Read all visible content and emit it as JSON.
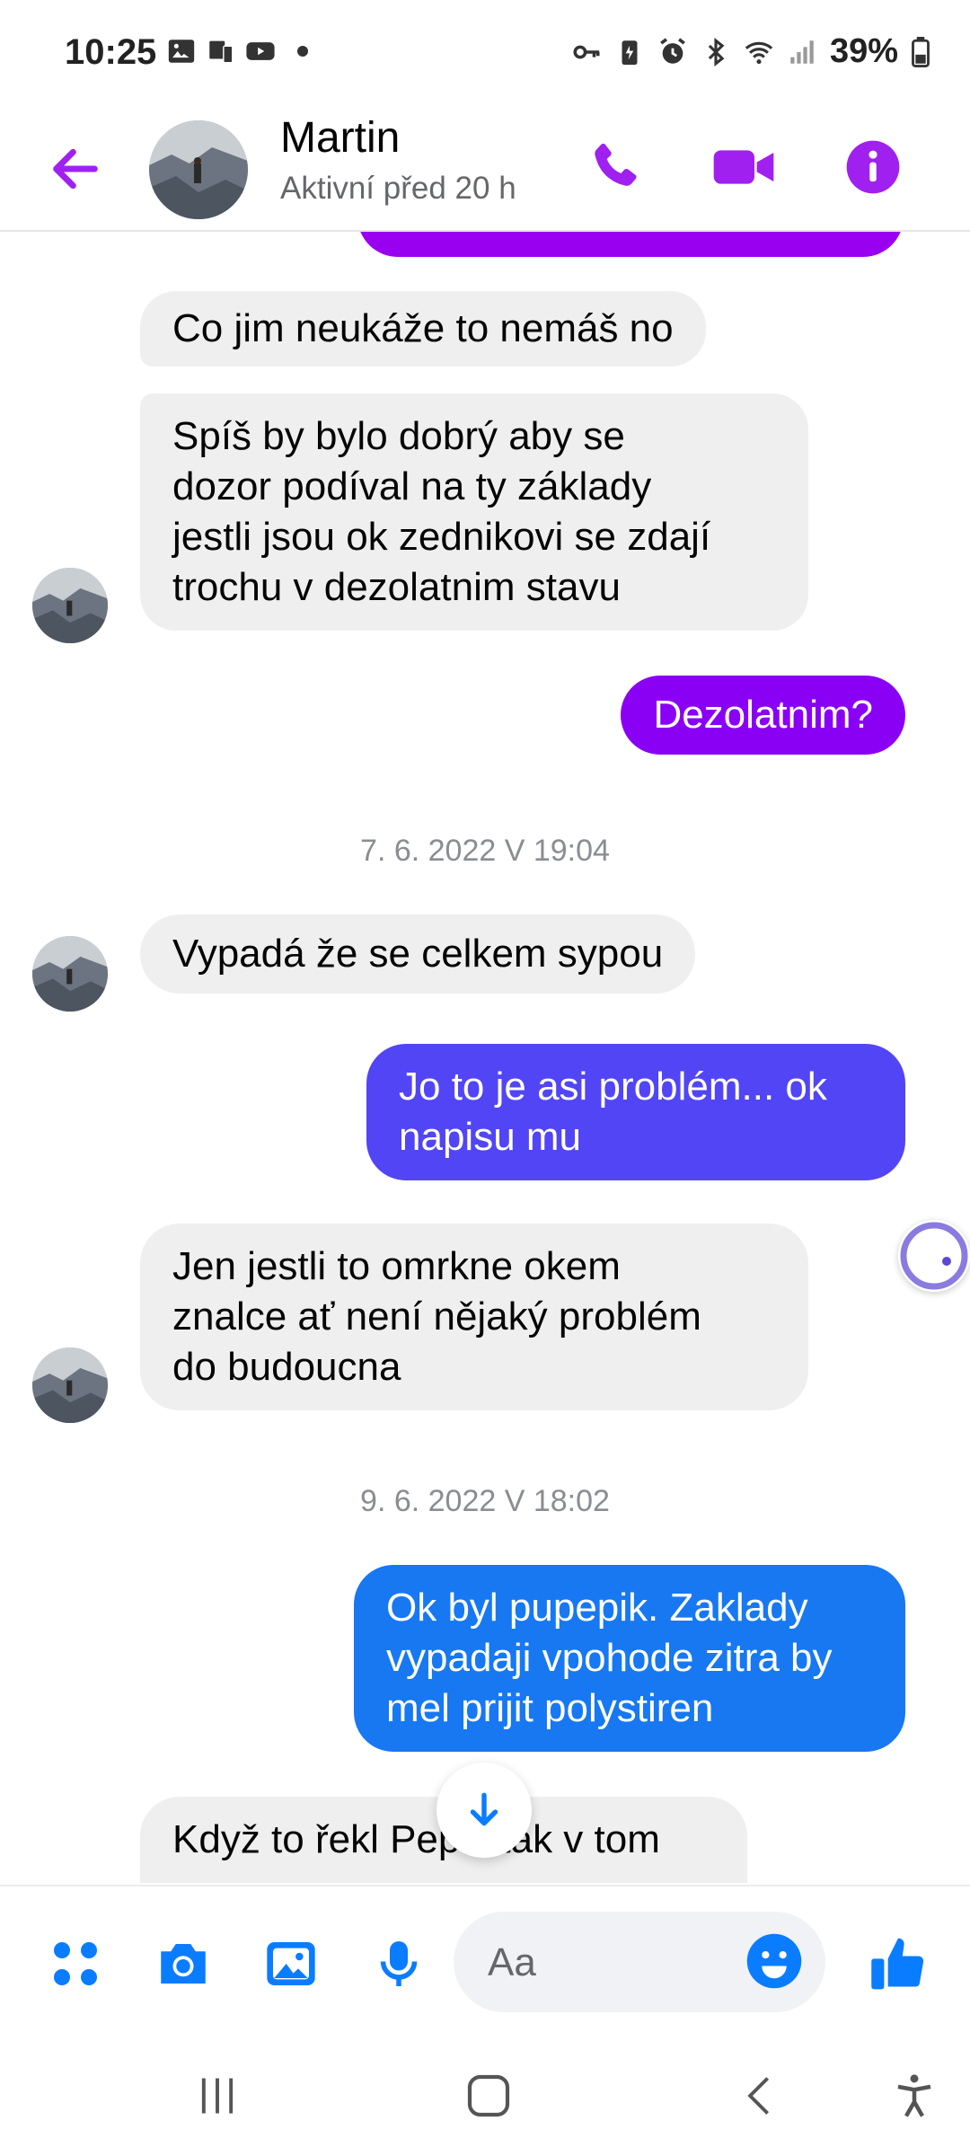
{
  "status_bar": {
    "time": "10:25",
    "battery": "39%"
  },
  "header": {
    "contact_name": "Martin",
    "contact_status": "Aktivní před 20 h"
  },
  "messages": [
    {
      "direction": "incoming",
      "text": "Co jim neukáže to nemáš no"
    },
    {
      "direction": "incoming",
      "text": "Spíš by bylo dobrý aby se\ndozor podíval na ty základy\njestli jsou ok zednikovi se zdají\ntrochu v dezolatnim stavu"
    },
    {
      "direction": "outgoing",
      "text": "Dezolatnim?",
      "color": "#8a00f5"
    },
    {
      "direction": "timestamp",
      "text": "7. 6. 2022 V 19:04"
    },
    {
      "direction": "incoming",
      "text": "Vypadá že se celkem sypou"
    },
    {
      "direction": "outgoing",
      "text": "Jo to je asi problém... ok\nnapisu mu",
      "color": "#5145f6"
    },
    {
      "direction": "incoming",
      "text": "Jen jestli to omrkne okem\nznalce ať není nějaký problém\ndo budoucna"
    },
    {
      "direction": "timestamp",
      "text": "9. 6. 2022 V 18:02"
    },
    {
      "direction": "outgoing",
      "text": "Ok byl pupepik. Zaklady\nvypadaji vpohode zitra by\nmel prijit polystiren",
      "color": "#1778f2"
    },
    {
      "direction": "incoming",
      "text": "Když to řekl Pepik tak v tom"
    }
  ],
  "composer": {
    "placeholder": "Aa"
  },
  "colors": {
    "accent_purple": "#a020f0",
    "accent_blue": "#0a7cff",
    "incoming_bg": "#efefef"
  },
  "icons": {
    "header": [
      "back-arrow-icon",
      "phone-icon",
      "video-camera-icon",
      "info-icon"
    ],
    "composer": [
      "apps-grid-icon",
      "camera-icon",
      "gallery-icon",
      "microphone-icon",
      "emoji-icon",
      "thumbs-up-icon"
    ],
    "navigation": [
      "recent-apps-icon",
      "home-icon",
      "back-icon",
      "accessibility-icon"
    ]
  }
}
